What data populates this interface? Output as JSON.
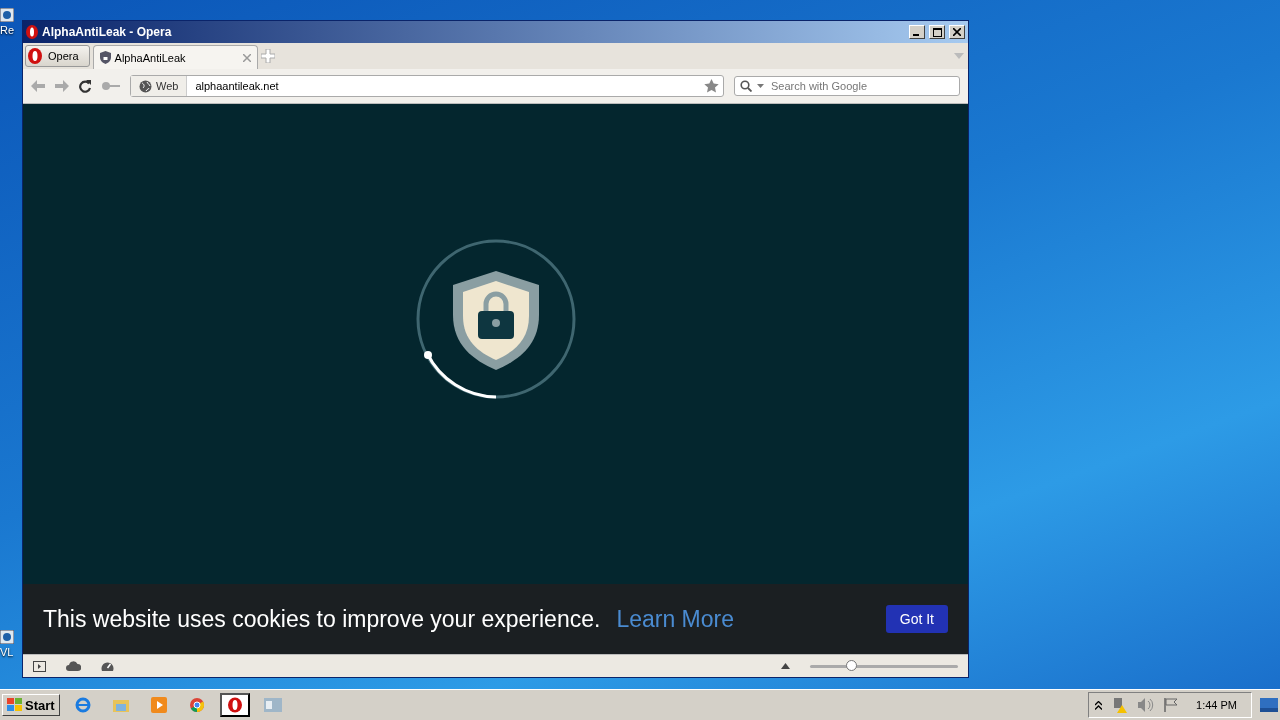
{
  "desktop": {
    "icons": [
      {
        "label": "Re"
      },
      {
        "label": "VL"
      }
    ]
  },
  "window": {
    "title": "AlphaAntiLeak - Opera"
  },
  "menu_button": {
    "label": "Opera"
  },
  "tabs": [
    {
      "label": "AlphaAntiLeak",
      "selected": true
    }
  ],
  "toolbar": {
    "address_badge": "Web",
    "url": "alphaantileak.net",
    "search": {
      "placeholder": "Search with Google"
    }
  },
  "cookie_banner": {
    "text": "This website uses cookies to improve your experience.",
    "link": "Learn More",
    "button": "Got It"
  },
  "status_bar": {
    "zoom": {
      "level": 0.28
    }
  },
  "taskbar": {
    "start": "Start",
    "apps": [
      {
        "kind": "ie",
        "selected": false
      },
      {
        "kind": "folder",
        "selected": false
      },
      {
        "kind": "media",
        "selected": false
      },
      {
        "kind": "chrome",
        "selected": false
      },
      {
        "kind": "opera",
        "selected": true
      },
      {
        "kind": "window",
        "selected": false
      }
    ],
    "clock": "1:44 PM"
  }
}
